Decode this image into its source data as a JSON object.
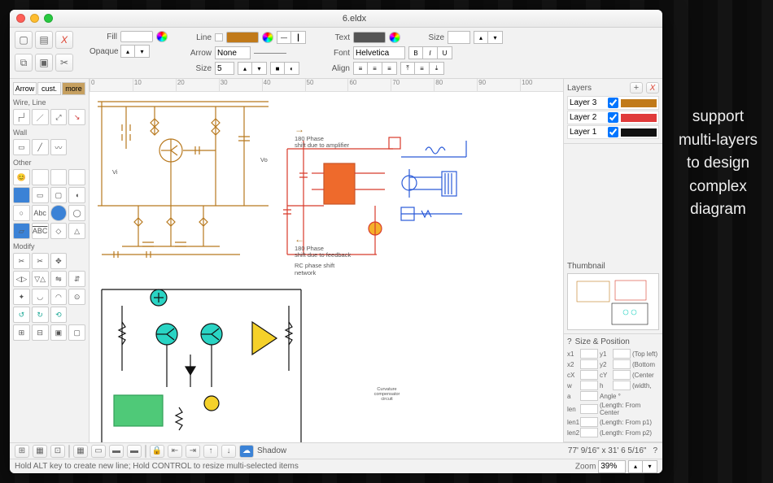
{
  "window": {
    "title": "6.eldx"
  },
  "toolbar": {
    "fill_label": "Fill",
    "opaque_label": "Opaque",
    "line_label": "Line",
    "arrow_label": "Arrow",
    "arrow_value": "None",
    "size_label": "Size",
    "size_value": "5",
    "text_label": "Text",
    "fontsize_label": "Size",
    "font_label": "Font",
    "font_value": "Helvetica",
    "align_label": "Align"
  },
  "palette": {
    "tabs": [
      "Arrow",
      "cust.",
      "more"
    ],
    "sections": {
      "wire": "Wire, Line",
      "wall": "Wall",
      "other": "Other",
      "modify": "Modify"
    },
    "sample_label": "Abc",
    "sample_label2": "ABC"
  },
  "layers": {
    "title": "Layers",
    "add_icon": "+",
    "del_icon": "X",
    "items": [
      {
        "name": "Layer 3",
        "color": "#c17a1a"
      },
      {
        "name": "Layer 2",
        "color": "#e03a3a"
      },
      {
        "name": "Layer 1",
        "color": "#111111"
      }
    ]
  },
  "thumbnail": {
    "title": "Thumbnail"
  },
  "sizepos": {
    "title": "Size & Position",
    "q": "?",
    "rows": [
      {
        "a": "x1",
        "b": "y1",
        "desc": "(Top left)"
      },
      {
        "a": "x2",
        "b": "y2",
        "desc": "(Bottom"
      },
      {
        "a": "cX",
        "b": "cY",
        "desc": "(Center"
      },
      {
        "a": "w",
        "b": "h",
        "desc": "(width, "
      },
      {
        "a": "a",
        "b": "",
        "desc": "Angle °"
      },
      {
        "a": "len",
        "b": "",
        "desc": "(Length: From Center"
      },
      {
        "a": "len1",
        "b": "",
        "desc": "(Length: From p1)"
      },
      {
        "a": "len2",
        "b": "",
        "desc": "(Length: From p2)"
      }
    ]
  },
  "canvas_notes": {
    "note1a": "180 Phase",
    "note1b": "shift due to amplifier",
    "note2a": "180 Phase",
    "note2b": "shift due to feedback",
    "note3a": "RC phase shift",
    "note3b": "network",
    "vi": "Vi",
    "vo": "Vo",
    "curv_box": "Curvature\ncompensator\ncircuit"
  },
  "bottom": {
    "shadow_label": "Shadow",
    "dims": "77' 9/16\" x 31' 6 5/16\"",
    "q": "?"
  },
  "status": {
    "hint": "Hold ALT key to create new line; Hold CONTROL to resize multi-selected items",
    "zoom_label": "Zoom",
    "zoom_value": "39%"
  },
  "callout": {
    "l1": "support",
    "l2": "multi-layers",
    "l3": "to design",
    "l4": "complex",
    "l5": "diagram"
  },
  "ruler": [
    "0",
    "10",
    "20",
    "30",
    "40",
    "50",
    "60",
    "70",
    "80",
    "90",
    "100"
  ]
}
